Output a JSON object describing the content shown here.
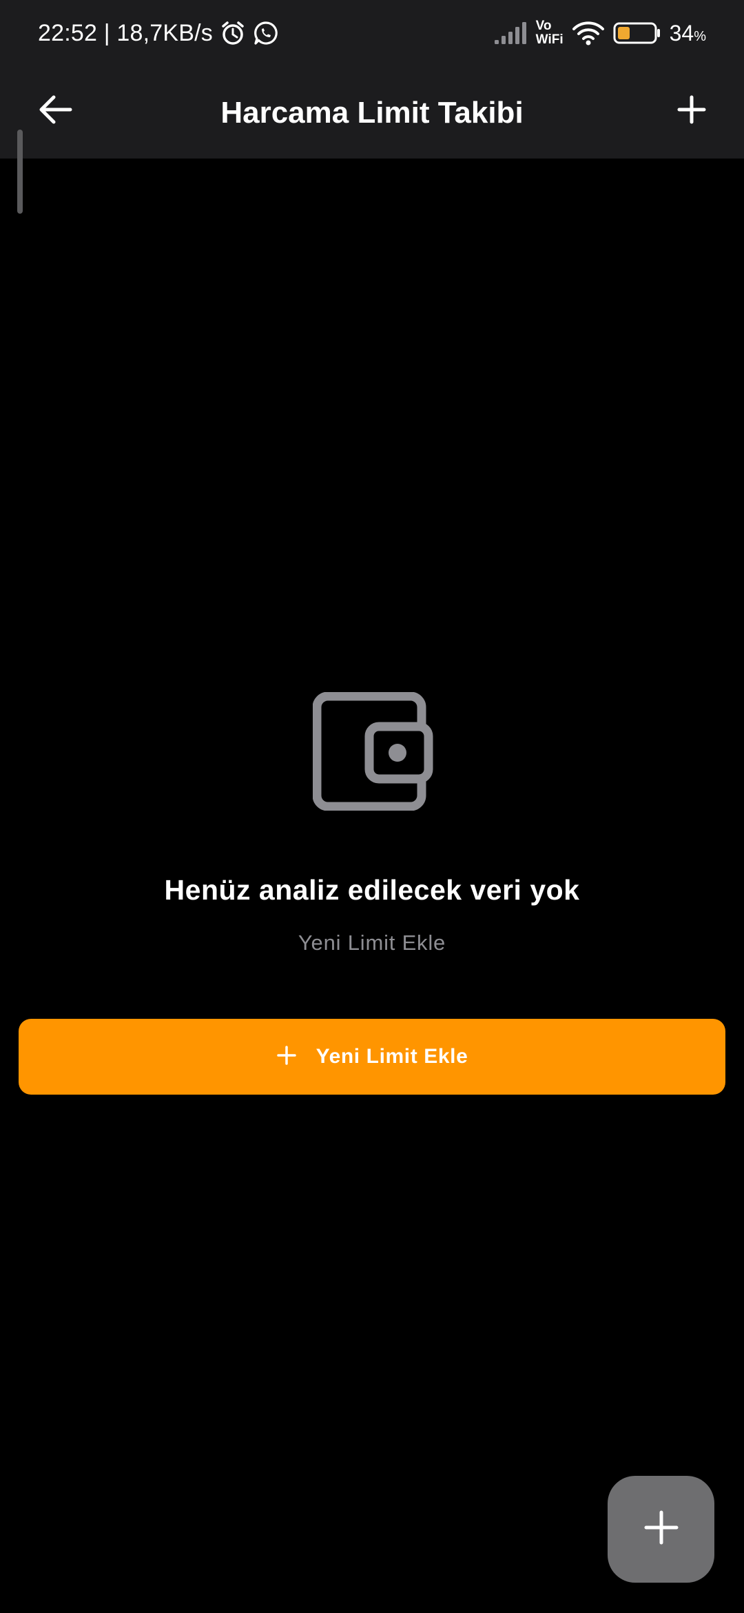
{
  "status_bar": {
    "time_speed": "22:52 | 18,7KB/s",
    "icons": [
      "alarm-icon",
      "whatsapp-icon",
      "signal-icon",
      "vowifi-icon",
      "wifi-icon",
      "battery-icon"
    ],
    "vowifi_line1": "Vo",
    "vowifi_line2": "WiFi",
    "battery_number": "34",
    "battery_unit": "%",
    "battery_level": 0.34,
    "battery_color": "#f0a830"
  },
  "app_bar": {
    "title": "Harcama Limit Takibi",
    "back_icon": "arrow-left-icon",
    "add_icon": "plus-icon"
  },
  "empty_state": {
    "icon": "wallet-icon",
    "title": "Henüz analiz edilecek veri yok",
    "subtitle": "Yeni Limit Ekle"
  },
  "primary_button": {
    "icon": "plus-icon",
    "label": "Yeni Limit Ekle",
    "color": "#ff9500"
  },
  "fab": {
    "icon": "plus-icon",
    "color": "#6e6e70"
  },
  "colors": {
    "background": "#000000",
    "bars": "#1c1c1e",
    "muted_text": "#8e8e93",
    "icon_gray": "#8e8e93"
  }
}
